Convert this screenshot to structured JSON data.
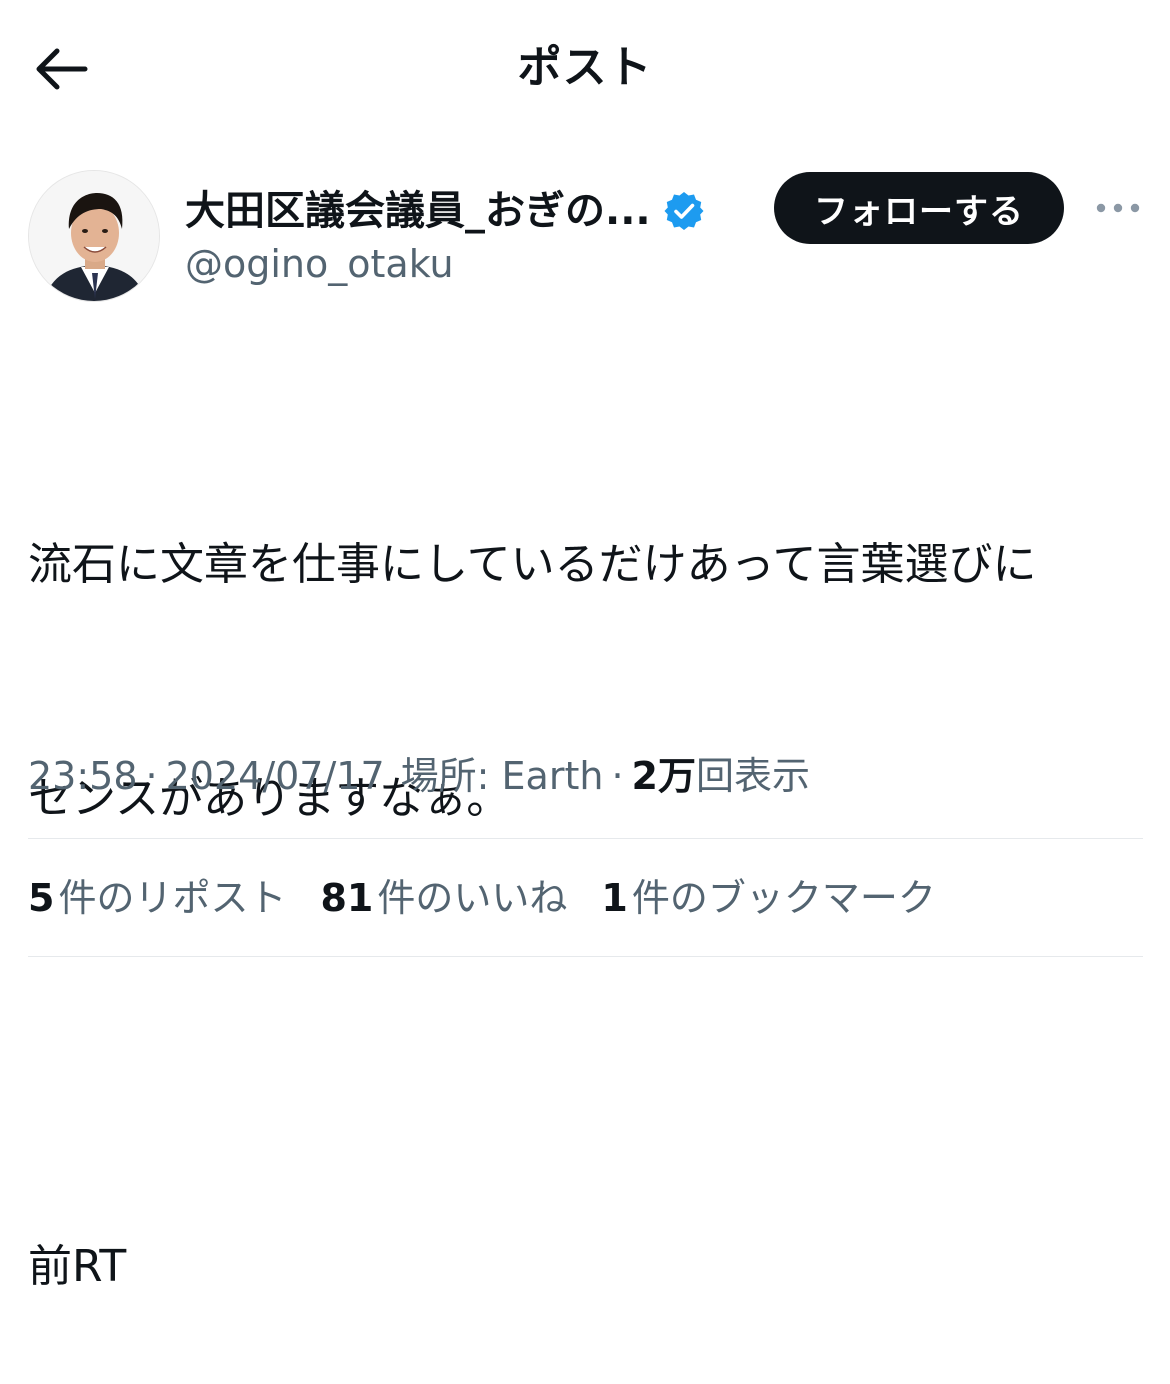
{
  "header": {
    "title": "ポスト",
    "back_icon": "arrow-left-icon"
  },
  "author": {
    "name": "大田区議会議員_おぎの...",
    "handle": "@ogino_otaku",
    "verified": true,
    "verified_color": "#1d9bf0",
    "follow_label": "フォローする",
    "more_icon": "more-horizontal-icon"
  },
  "tweet": {
    "line1": "流石に文章を仕事にしているだけあって言葉選びに",
    "line2": "センスがありますなぁ。",
    "line3": "前RT"
  },
  "meta": {
    "time": "23:58",
    "separator": "·",
    "date": "2024/07/17",
    "location": "場所: Earth",
    "views_count": "2万",
    "views_label": "回表示"
  },
  "stats": {
    "reposts_count": "5",
    "reposts_label": "件のリポスト",
    "likes_count": "81",
    "likes_label": "件のいいね",
    "bookmarks_count": "1",
    "bookmarks_label": "件のブックマーク"
  },
  "colors": {
    "text": "#0f1419",
    "secondary": "#536471",
    "follow_bg": "#0f1419",
    "divider": "#e6e9ec"
  }
}
